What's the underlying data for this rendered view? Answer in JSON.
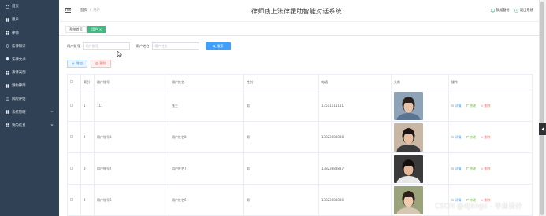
{
  "sidebar": {
    "items": [
      {
        "label": "首页",
        "icon": "home-icon"
      },
      {
        "label": "用户",
        "icon": "grid-icon"
      },
      {
        "label": "律师",
        "icon": "grid-icon"
      },
      {
        "label": "法律知识",
        "icon": "light-icon"
      },
      {
        "label": "法律文书",
        "icon": "pin-icon"
      },
      {
        "label": "法律案例",
        "icon": "grid-icon"
      },
      {
        "label": "预约律师",
        "icon": "grid-icon"
      },
      {
        "label": "风险评估",
        "icon": "doc-icon"
      },
      {
        "label": "系统管理",
        "icon": "grid-icon",
        "expandable": true
      },
      {
        "label": "我的信息",
        "icon": "grid-icon",
        "expandable": true
      }
    ]
  },
  "header": {
    "breadcrumb": {
      "home": "首页",
      "current": "用户"
    },
    "title": "律师线上法律援助智能对话系统",
    "backup_label": "数据备份",
    "logout_label": "退出系统"
  },
  "tabs": {
    "home": "系统首页",
    "active": "用户 ×"
  },
  "search": {
    "account_label": "用户账号",
    "account_placeholder": "用户账号",
    "name_label": "用户姓名",
    "name_placeholder": "用户姓名",
    "button_label": "搜索"
  },
  "actions": {
    "add_label": "增加",
    "delete_label": "删除"
  },
  "table": {
    "headers": [
      "",
      "索引",
      "用户账号",
      "用户姓名",
      "性别",
      "电话",
      "头像",
      "操作"
    ],
    "rows": [
      {
        "index": "1",
        "account": "111",
        "name": "张三",
        "gender": "男",
        "phone": "13511111111"
      },
      {
        "index": "2",
        "account": "用户账号8",
        "name": "用户姓名8",
        "gender": "男",
        "phone": "13823888888"
      },
      {
        "index": "3",
        "account": "用户账号7",
        "name": "用户姓名7",
        "gender": "男",
        "phone": "13823888887"
      },
      {
        "index": "4",
        "account": "用户账号6",
        "name": "用户姓名6",
        "gender": "男",
        "phone": "13823888886"
      }
    ],
    "ops": {
      "view": "详情",
      "edit": "修改",
      "delete": "删除"
    }
  },
  "watermark": "CSDN @django - 毕业设计",
  "colors": {
    "sidebar_bg": "#304156",
    "primary": "#409eff",
    "active_tab": "#42b983",
    "danger": "#f56c6c",
    "success": "#67c23a"
  }
}
